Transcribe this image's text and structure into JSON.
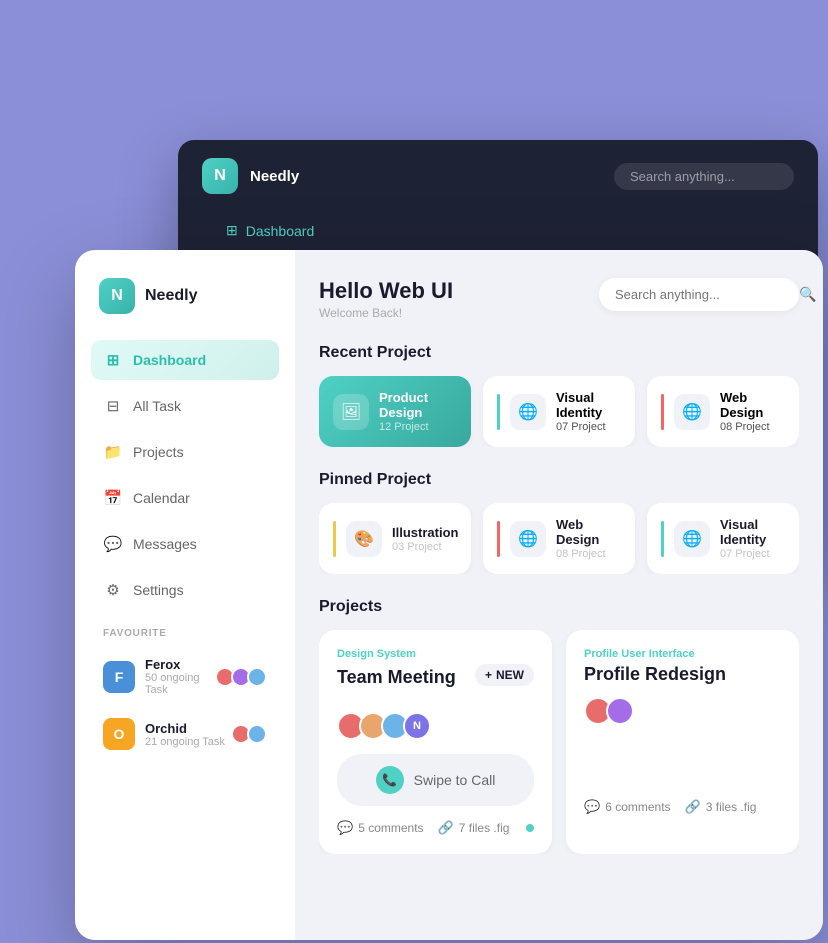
{
  "app": {
    "brand": "Needly",
    "logo_letter": "N"
  },
  "bg_card": {
    "brand": "Needly",
    "search_placeholder": "Search anything...",
    "nav_active": "Dashboard",
    "title": "Hello Web UI",
    "subtitle": "Welcome Back!",
    "section": "Recent Project"
  },
  "header": {
    "title": "Hello Web UI",
    "subtitle": "Welcome Back!",
    "search_placeholder": "Search anything..."
  },
  "sidebar": {
    "brand": "Needly",
    "logo_letter": "N",
    "nav_items": [
      {
        "label": "Dashboard",
        "icon": "⊞",
        "active": true
      },
      {
        "label": "All Task",
        "icon": "⊟",
        "active": false
      },
      {
        "label": "Projects",
        "icon": "📁",
        "active": false
      },
      {
        "label": "Calendar",
        "icon": "📅",
        "active": false
      },
      {
        "label": "Messages",
        "icon": "💬",
        "active": false
      },
      {
        "label": "Settings",
        "icon": "⚙",
        "active": false
      }
    ],
    "section_label": "FAVOURITE",
    "favourites": [
      {
        "name": "Ferox",
        "tasks": "50 ongoing Task",
        "color": "#4a90d9",
        "letter": "F"
      },
      {
        "name": "Orchid",
        "tasks": "21 ongoing Task",
        "color": "#f6a623",
        "letter": "O"
      }
    ]
  },
  "recent_projects": {
    "title": "Recent Project",
    "items": [
      {
        "name": "Product Design",
        "count": "12 Project",
        "featured": true,
        "accent": "green"
      },
      {
        "name": "Visual Identity",
        "count": "07 Project",
        "featured": false,
        "accent": "green"
      },
      {
        "name": "Web Design",
        "count": "08 Project",
        "featured": false,
        "accent": "red"
      }
    ]
  },
  "pinned_projects": {
    "title": "Pinned Project",
    "items": [
      {
        "name": "Illustration",
        "count": "03 Project",
        "accent": "yellow"
      },
      {
        "name": "Web Design",
        "count": "08 Project",
        "accent": "red"
      },
      {
        "name": "Visual Identity",
        "count": "07 Project",
        "accent": "green"
      }
    ]
  },
  "projects": {
    "title": "Projects",
    "items": [
      {
        "category": "Design System",
        "title": "Team Meeting",
        "new_label": "NEW",
        "avatars": [
          "#e86c6c",
          "#e8a56c",
          "#6cb4e8",
          "#a56ce8"
        ],
        "avatar_letter": "N",
        "swipe_to_call": "Swipe to Call",
        "comments": "5 comments",
        "files": "7 files .fig",
        "has_dot": true
      },
      {
        "category": "Profile User Interface",
        "title": "Profile Redesign",
        "comments": "6 comments",
        "files": "3 files .fig",
        "has_dot": false
      }
    ]
  }
}
